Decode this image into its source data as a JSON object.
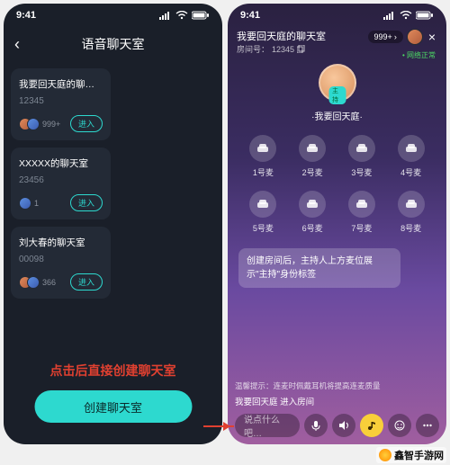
{
  "status": {
    "time": "9:41"
  },
  "left": {
    "title": "语音聊天室",
    "cards": [
      {
        "title": "我要回天庭的聊天室",
        "id": "12345",
        "count": "999+",
        "enter": "进入"
      },
      {
        "title": "XXXXX的聊天室",
        "id": "23456",
        "count": "1",
        "enter": "进入"
      },
      {
        "title": "刘大春的聊天室",
        "id": "00098",
        "count": "366",
        "enter": "进入"
      }
    ],
    "annotation": "点击后直接创建聊天室",
    "create": "创建聊天室"
  },
  "right": {
    "room_name": "我要回天庭的聊天室",
    "room_id_label": "房间号：",
    "room_id": "12345",
    "count": "999+",
    "net_status": "• 网络正常",
    "host_badge": "主持",
    "host_name": "·我要回天庭·",
    "seats": [
      "1号麦",
      "2号麦",
      "3号麦",
      "4号麦",
      "5号麦",
      "6号麦",
      "7号麦",
      "8号麦"
    ],
    "bubble": "创建房间后，主持人上方麦位展示\"主持\"身份标签",
    "tip": "温馨提示：连麦时佩戴耳机将提高连麦质量",
    "notice": "我要回天庭 进入房间",
    "placeholder": "说点什么吧…"
  },
  "watermark": "鑫智手游网"
}
